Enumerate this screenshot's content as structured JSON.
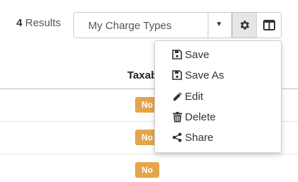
{
  "results": {
    "count": "4",
    "label": " Results"
  },
  "view_select": {
    "selected": "My Charge Types",
    "caret": "▼"
  },
  "table": {
    "column_header": "Taxab",
    "rows": [
      {
        "taxable": "No"
      },
      {
        "taxable": "No"
      },
      {
        "taxable": "No"
      }
    ]
  },
  "settings_menu": {
    "items": [
      {
        "label": "Save",
        "icon": "floppy-disk-icon"
      },
      {
        "label": "Save As",
        "icon": "floppy-disk-icon"
      },
      {
        "label": "Edit",
        "icon": "pencil-icon"
      },
      {
        "label": "Delete",
        "icon": "trash-icon"
      },
      {
        "label": "Share",
        "icon": "share-icon"
      }
    ]
  },
  "colors": {
    "badge": "#e6a54a",
    "active_button": "#e6e6e6"
  }
}
